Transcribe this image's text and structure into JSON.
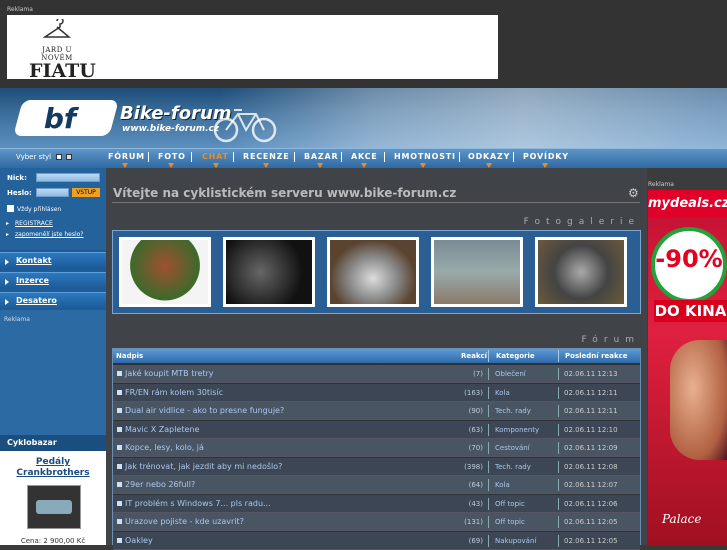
{
  "top_ad": {
    "label": "Reklama",
    "brand_small": "JARD U NOVÉM",
    "brand_big": "FIATU"
  },
  "header": {
    "logo": "bf",
    "site_name": "Bike-forum",
    "site_url": "www.bike-forum.cz"
  },
  "style_selector": {
    "label": "Vyber styl"
  },
  "nav": {
    "items": [
      "FÓRUM",
      "FOTO",
      "CHAT",
      "RECENZE",
      "BAZAR",
      "AKCE",
      "HMOTNOSTI",
      "ODKAZY",
      "POVÍDKY"
    ],
    "active_color": "#f28a1a"
  },
  "login": {
    "nick_label": "Nick:",
    "password_label": "Heslo:",
    "submit_label": "VSTUP",
    "remember_label": "Vždy přihlásen",
    "register_link": "REGISTRACE",
    "forgot_link": "zapomenělí jste heslo?"
  },
  "left_menu": {
    "items": [
      "Kontakt",
      "Inzerce",
      "Desatero"
    ]
  },
  "left_ad": {
    "label": "Reklama"
  },
  "cyklobazar": {
    "title": "Cyklobazar",
    "item_name_line1": "Pedály",
    "item_name_line2": "Crankbrothers",
    "price": "Cena: 2 900,00 Kč"
  },
  "main": {
    "welcome": "Vítejte na cyklistickém serveru www.bike-forum.cz",
    "gallery_title": "Fotogalerie",
    "forum_title": "Fórum"
  },
  "forum": {
    "columns": {
      "topic": "Nadpis",
      "replies": "Reakcí",
      "category": "Kategorie",
      "last": "Poslední reakce"
    },
    "rows": [
      {
        "title": "Jaké koupit MTB tretry",
        "count": "(7)",
        "category": "Oblečení",
        "date": "02.06.11 12:13"
      },
      {
        "title": "FR/EN rám kolem 30tisíc",
        "count": "(163)",
        "category": "Kola",
        "date": "02.06.11 12:11"
      },
      {
        "title": "Dual air vidlice - ako to presne funguje?",
        "count": "(90)",
        "category": "Tech. rady",
        "date": "02.06.11 12:11"
      },
      {
        "title": "Mavic X Zapletene",
        "count": "(63)",
        "category": "Komponenty",
        "date": "02.06.11 12:10"
      },
      {
        "title": "Kopce, lesy, kolo, já",
        "count": "(70)",
        "category": "Cestování",
        "date": "02.06.11 12:09"
      },
      {
        "title": "Jak trénovat, jak jezdit aby mi nedošlo?",
        "count": "(398)",
        "category": "Tech. rady",
        "date": "02.06.11 12:08"
      },
      {
        "title": "29er nebo 26full?",
        "count": "(64)",
        "category": "Kola",
        "date": "02.06.11 12:07"
      },
      {
        "title": "IT problém s Windows 7... pls radu...",
        "count": "(43)",
        "category": "Off topic",
        "date": "02.06.11 12:06"
      },
      {
        "title": "Urazove pojiste - kde uzavrit?",
        "count": "(131)",
        "category": "Off topic",
        "date": "02.06.11 12:05"
      },
      {
        "title": "Oakley",
        "count": "(69)",
        "category": "Nakupování",
        "date": "02.06.11 12:05"
      }
    ]
  },
  "right_ad": {
    "label": "Reklama",
    "brand": "mydeals.cz",
    "discount": "-90%",
    "slogan": "DO KINA",
    "cinema": "Palace"
  }
}
